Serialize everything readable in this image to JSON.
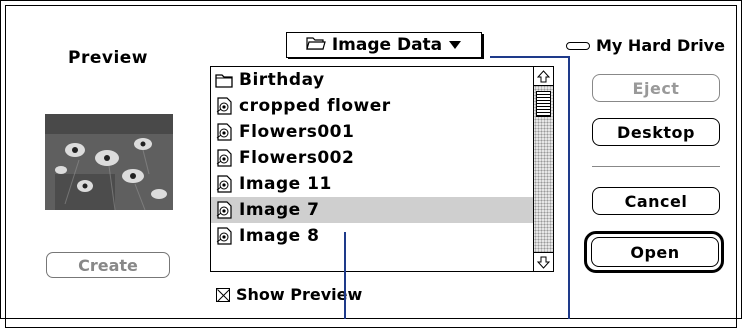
{
  "dialog": {
    "preview_label": "Preview",
    "create_label": "Create",
    "show_preview_label": "Show Preview",
    "show_preview_checked": true
  },
  "folder_popup": {
    "label": "Image Data",
    "icon": "open-folder-icon"
  },
  "drive": {
    "label": "My Hard Drive",
    "icon": "hard-drive-icon"
  },
  "buttons": {
    "eject": "Eject",
    "desktop": "Desktop",
    "cancel": "Cancel",
    "open": "Open"
  },
  "file_list": {
    "items": [
      {
        "name": "Birthday",
        "icon": "folder-icon",
        "selected": false
      },
      {
        "name": "cropped flower",
        "icon": "picture-document-icon",
        "selected": false
      },
      {
        "name": "Flowers001",
        "icon": "picture-document-icon",
        "selected": false
      },
      {
        "name": "Flowers002",
        "icon": "picture-document-icon",
        "selected": false
      },
      {
        "name": "Image 11",
        "icon": "picture-document-icon",
        "selected": false
      },
      {
        "name": "Image 7",
        "icon": "picture-document-icon",
        "selected": true
      },
      {
        "name": "Image 8",
        "icon": "picture-document-icon",
        "selected": false
      }
    ]
  },
  "colors": {
    "selection": "#cfcfcf",
    "callout_lines": "#1e3a8a"
  }
}
